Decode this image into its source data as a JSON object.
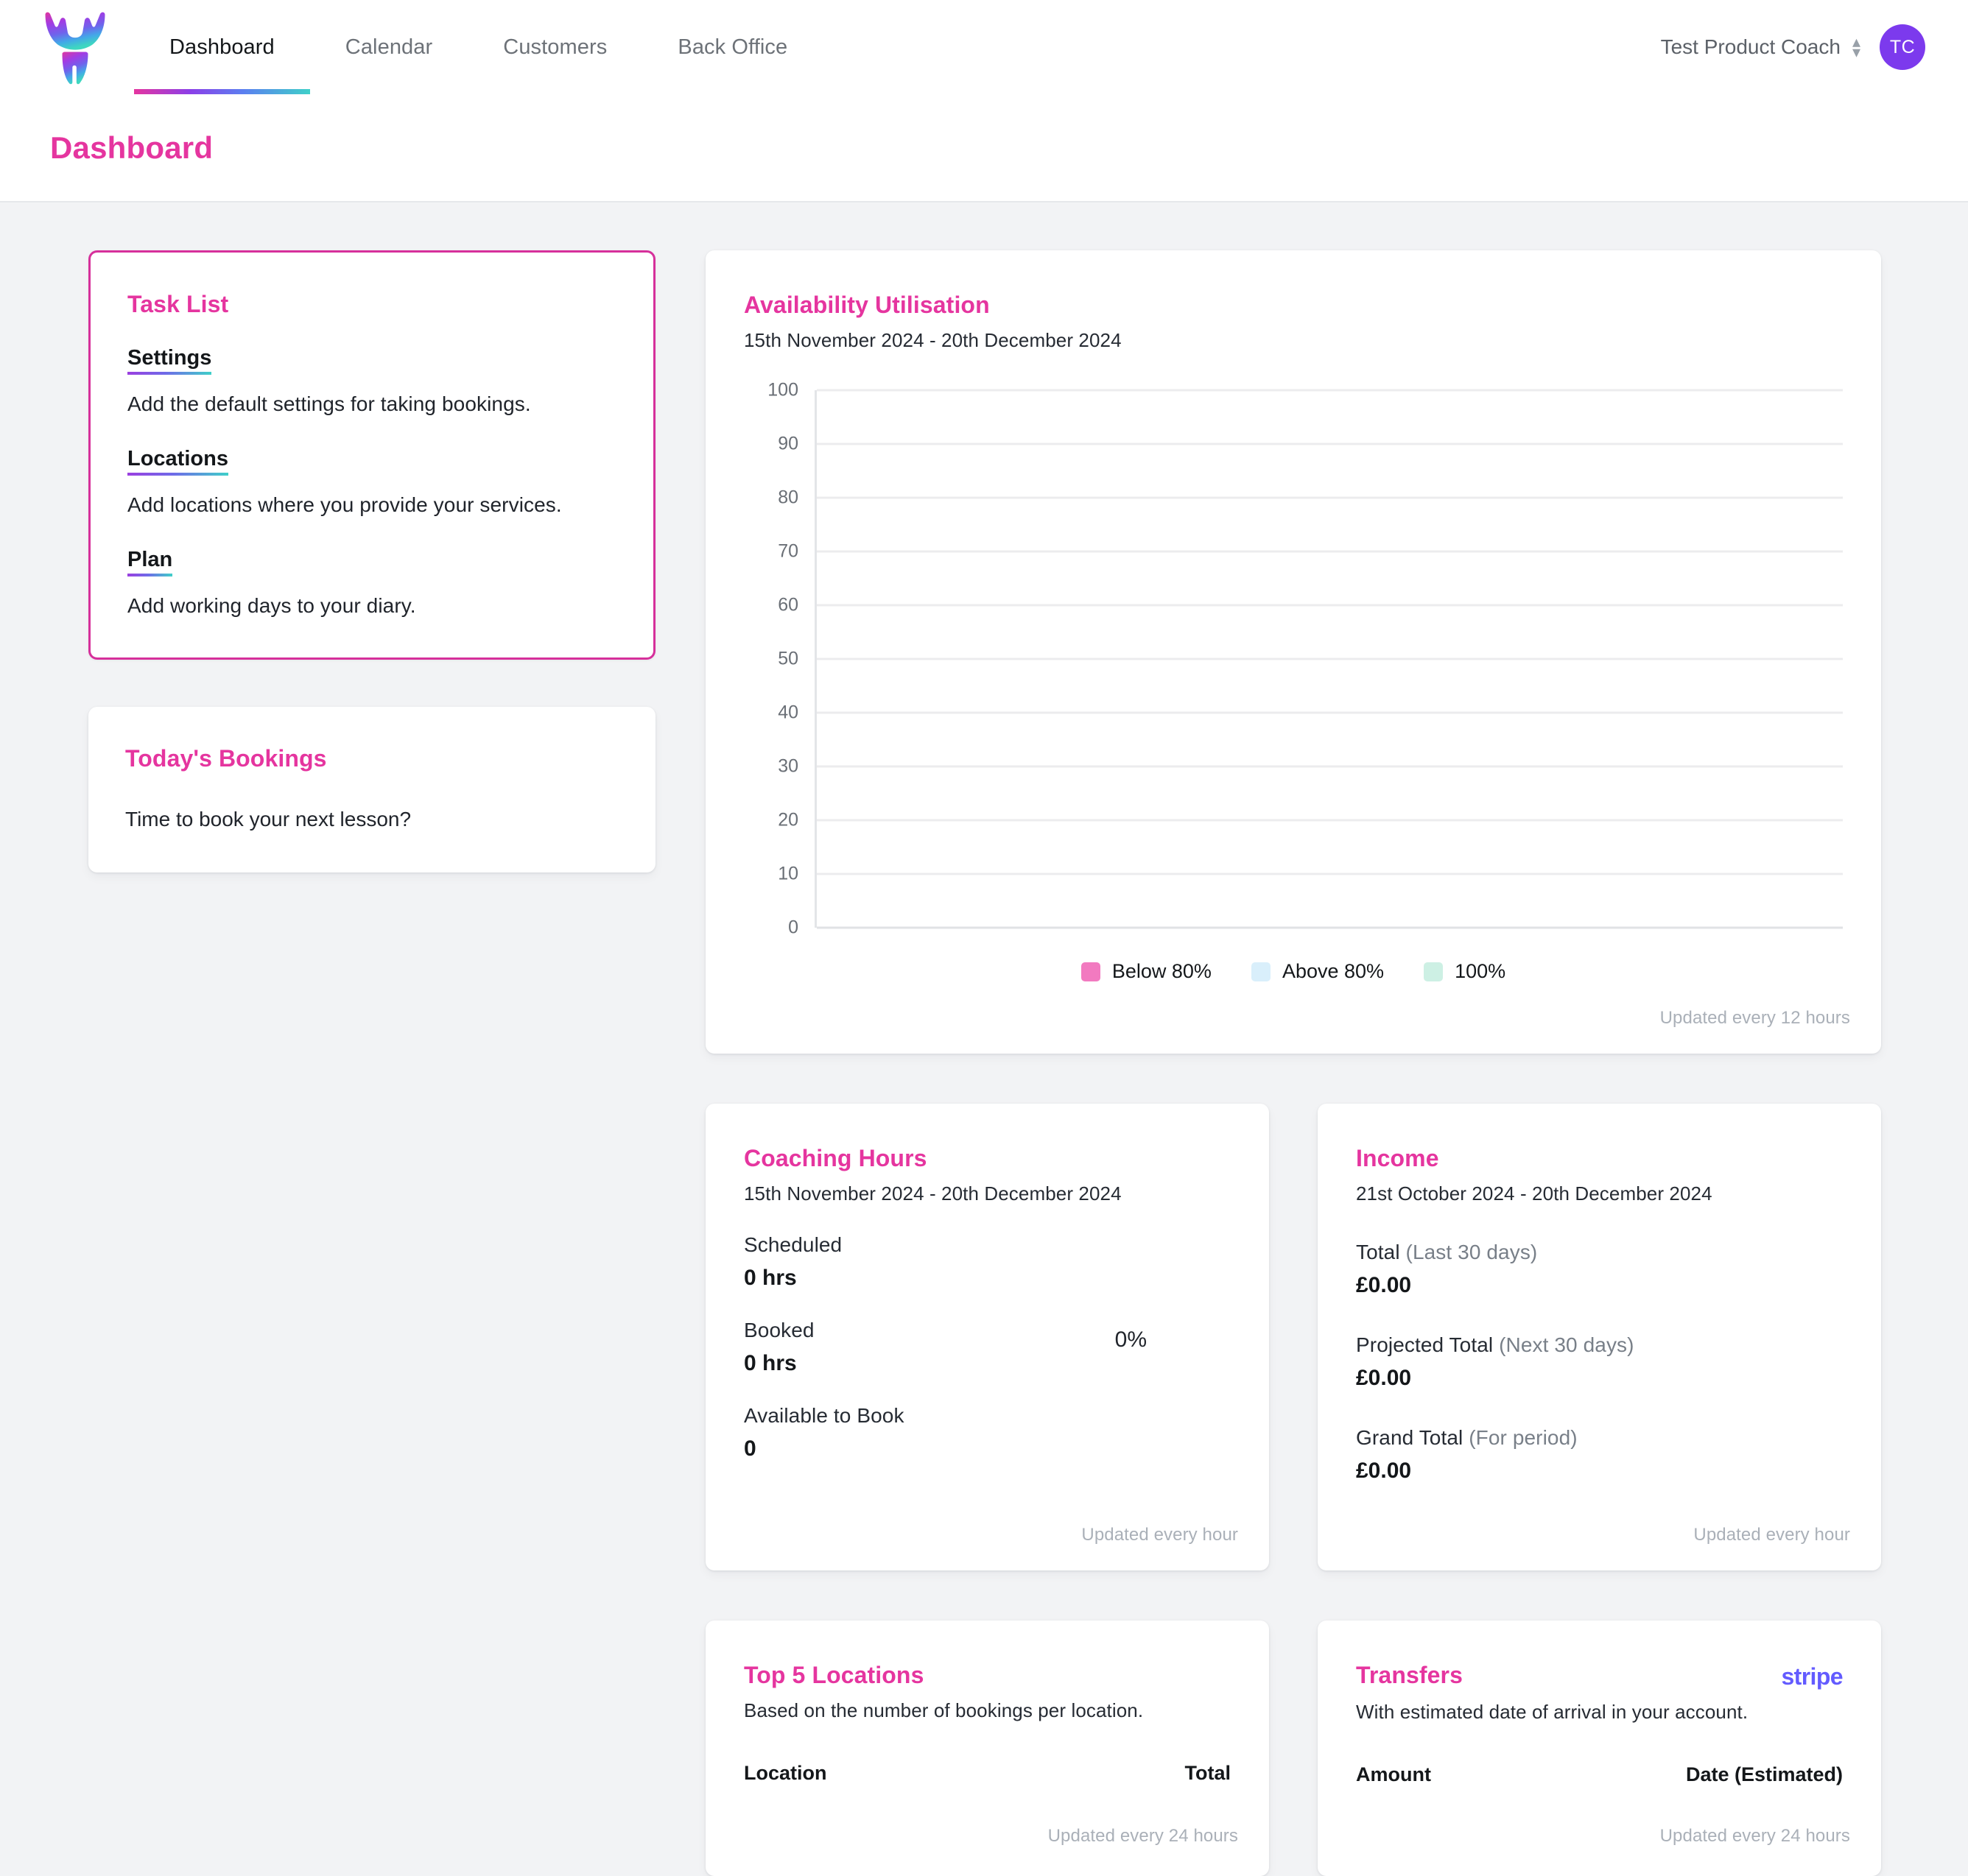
{
  "nav": {
    "logo_name": "antler-logo",
    "links": [
      {
        "label": "Dashboard",
        "active": true
      },
      {
        "label": "Calendar",
        "active": false
      },
      {
        "label": "Customers",
        "active": false
      },
      {
        "label": "Back Office",
        "active": false
      }
    ],
    "account_name": "Test Product Coach",
    "avatar_initials": "TC",
    "accent_pink": "#e5359f",
    "avatar_color": "#7c3aed"
  },
  "page": {
    "title": "Dashboard"
  },
  "task_list": {
    "title": "Task List",
    "items": [
      {
        "link": "Settings",
        "desc": "Add the default settings for taking bookings."
      },
      {
        "link": "Locations",
        "desc": "Add locations where you provide your services."
      },
      {
        "link": "Plan",
        "desc": "Add working days to your diary."
      }
    ]
  },
  "todays_bookings": {
    "title": "Today's Bookings",
    "body": "Time to book your next lesson?"
  },
  "availability": {
    "title": "Availability Utilisation",
    "date_range": "15th November 2024 - 20th December 2024",
    "updated": "Updated every 12 hours"
  },
  "chart_data": {
    "type": "bar",
    "title": "Availability Utilisation",
    "subtitle": "15th November 2024 - 20th December 2024",
    "xlabel": "",
    "ylabel": "",
    "ylim": [
      0,
      100
    ],
    "yticks": [
      0,
      10,
      20,
      30,
      40,
      50,
      60,
      70,
      80,
      90,
      100
    ],
    "grid": true,
    "legend_position": "bottom",
    "categories": [],
    "series": [
      {
        "name": "Below 80%",
        "color": "#f27ac0",
        "values": []
      },
      {
        "name": "Above 80%",
        "color": "#d9effb",
        "values": []
      },
      {
        "name": "100%",
        "color": "#cdf0e4",
        "values": []
      }
    ],
    "note": "No data plotted — empty chart area"
  },
  "coaching_hours": {
    "title": "Coaching Hours",
    "date_range": "15th November 2024 - 20th December 2024",
    "percentage": "0%",
    "stats": [
      {
        "label": "Scheduled",
        "value": "0 hrs"
      },
      {
        "label": "Booked",
        "value": "0 hrs"
      },
      {
        "label": "Available to Book",
        "value": "0"
      }
    ],
    "updated": "Updated every hour"
  },
  "income": {
    "title": "Income",
    "date_range": "21st October 2024 - 20th December 2024",
    "stats": [
      {
        "label": "Total",
        "qualifier": " (Last 30 days)",
        "value": "£0.00"
      },
      {
        "label": "Projected Total",
        "qualifier": " (Next 30 days)",
        "value": "£0.00"
      },
      {
        "label": "Grand Total",
        "qualifier": " (For period)",
        "value": "£0.00"
      }
    ],
    "updated": "Updated every hour"
  },
  "top_locations": {
    "title": "Top 5 Locations",
    "subtitle": "Based on the number of bookings per location.",
    "columns": [
      "Location",
      "Total"
    ],
    "rows": [],
    "updated": "Updated every 24 hours"
  },
  "transfers": {
    "title": "Transfers",
    "subtitle": "With estimated date of arrival in your account.",
    "provider_logo": "stripe",
    "columns": [
      "Amount",
      "Date (Estimated)"
    ],
    "rows": [],
    "updated": "Updated every 24 hours"
  }
}
